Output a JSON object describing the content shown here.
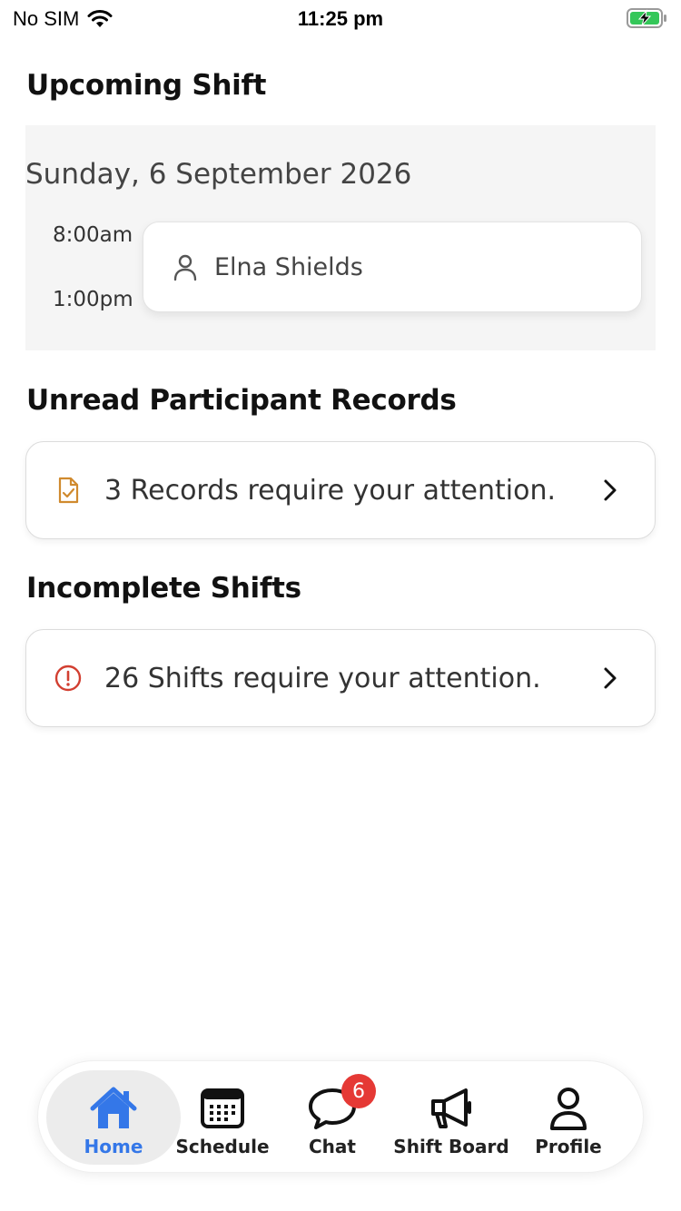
{
  "status_bar": {
    "carrier": "No SIM",
    "time": "11:25 pm"
  },
  "upcoming_shift": {
    "title": "Upcoming Shift",
    "date": "Sunday, 6 September 2026",
    "start_time": "8:00am",
    "end_time": "1:00pm",
    "participant_name": "Elna Shields"
  },
  "unread_records": {
    "title": "Unread Participant Records",
    "message": "3 Records require your attention.",
    "icon": "document-check-icon",
    "icon_color": "#d08a2e"
  },
  "incomplete_shifts": {
    "title": "Incomplete Shifts",
    "message": "26 Shifts require your attention.",
    "icon": "alert-circle-icon",
    "icon_color": "#d23f31"
  },
  "tab_bar": {
    "active_color": "#3477e8",
    "tabs": [
      {
        "label": "Home",
        "icon": "home-icon",
        "active": true
      },
      {
        "label": "Schedule",
        "icon": "calendar-icon",
        "active": false
      },
      {
        "label": "Chat",
        "icon": "chat-bubble-icon",
        "active": false,
        "badge": "6"
      },
      {
        "label": "Shift Board",
        "icon": "megaphone-icon",
        "active": false
      },
      {
        "label": "Profile",
        "icon": "person-icon",
        "active": false
      }
    ]
  }
}
